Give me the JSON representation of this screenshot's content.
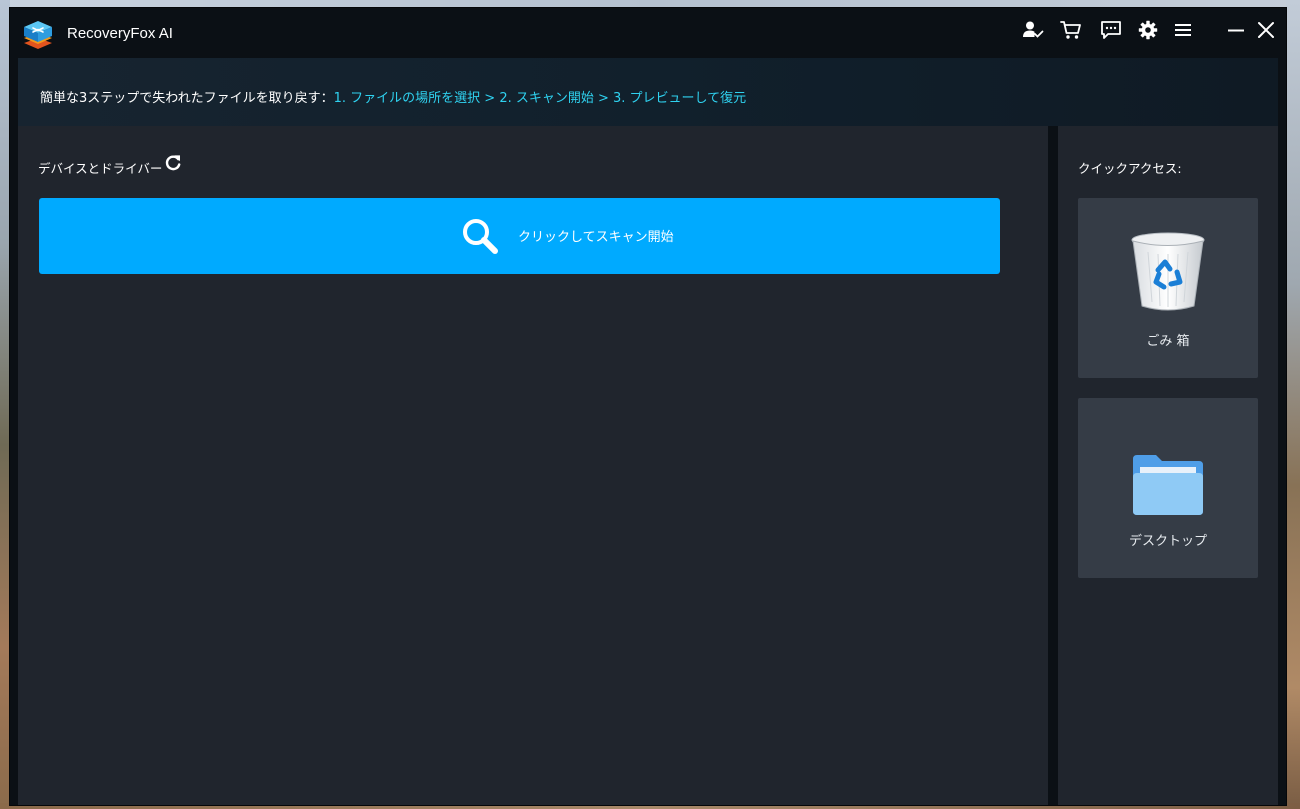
{
  "app": {
    "title": "RecoveryFox AI"
  },
  "titlebar": {
    "icons": [
      "account-icon",
      "cart-icon",
      "feedback-icon",
      "settings-icon",
      "menu-icon",
      "minimize-icon",
      "close-icon"
    ]
  },
  "banner": {
    "prefix": "簡単な3ステップで失われたファイルを取り戻す：",
    "steps": "1. ファイルの場所を選択 > 2. スキャン開始 > 3. プレビューして復元"
  },
  "devices": {
    "title": "デバイスとドライバー",
    "scan_button_label": "クリックしてスキャン開始"
  },
  "quick_access": {
    "title": "クイックアクセス:",
    "items": [
      {
        "label": "ごみ 箱",
        "icon": "recycle-bin-icon"
      },
      {
        "label": "デスクトップ",
        "icon": "folder-icon"
      }
    ]
  },
  "colors": {
    "accent": "#00aaff",
    "step_text": "#2fd2f0",
    "panel": "#20252d",
    "card": "#353c46",
    "titlebar": "#0b1015"
  }
}
